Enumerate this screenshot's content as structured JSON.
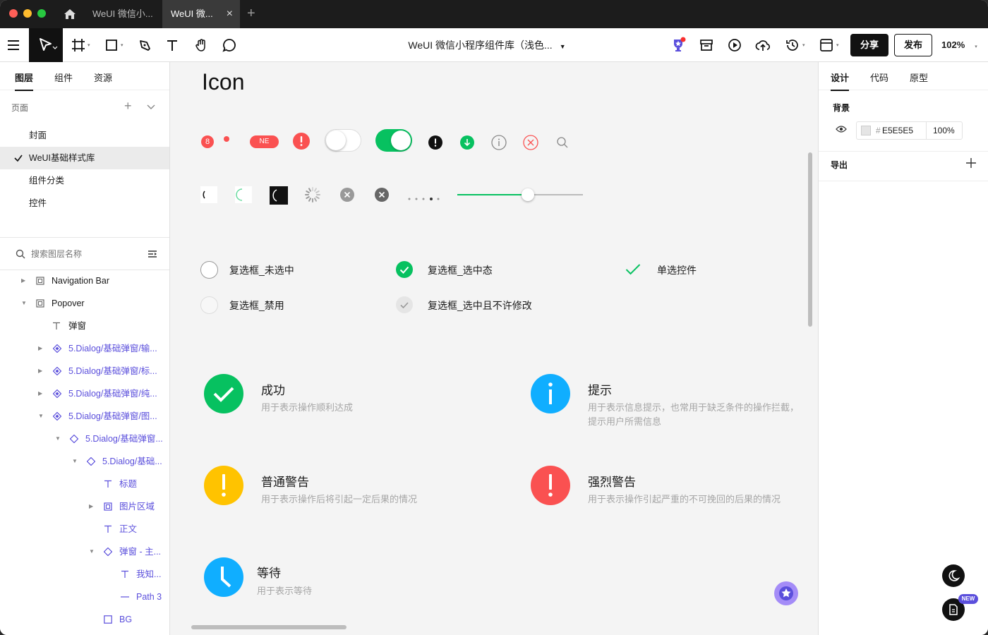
{
  "window": {
    "tabs": [
      {
        "label": "WeUI 微信小..."
      },
      {
        "label": "WeUI 微..."
      }
    ]
  },
  "toolbar": {
    "doc_title": "WeUI 微信小程序组件库（浅色...",
    "share_label": "分享",
    "publish_label": "发布",
    "zoom": "102%"
  },
  "left_panel": {
    "tabs": [
      "图层",
      "组件",
      "资源"
    ],
    "pages_header": "页面",
    "pages": [
      "封面",
      "WeUI基础样式库",
      "组件分类",
      "控件"
    ],
    "search_placeholder": "搜索图层名称",
    "layers": [
      {
        "label": "Navigation Bar",
        "type": "frame"
      },
      {
        "label": "Popover",
        "type": "frame"
      },
      {
        "label": "弹窗",
        "type": "text"
      },
      {
        "label": "5.Dialog/基础弹窗/输...",
        "type": "component"
      },
      {
        "label": "5.Dialog/基础弹窗/标...",
        "type": "component"
      },
      {
        "label": "5.Dialog/基础弹窗/纯...",
        "type": "component"
      },
      {
        "label": "5.Dialog/基础弹窗/图...",
        "type": "component"
      },
      {
        "label": "5.Dialog/基础弹窗...",
        "type": "instance"
      },
      {
        "label": "5.Dialog/基础...",
        "type": "instance"
      },
      {
        "label": "标题",
        "type": "text"
      },
      {
        "label": "图片区域",
        "type": "frame"
      },
      {
        "label": "正文",
        "type": "text"
      },
      {
        "label": "弹窗 - 主...",
        "type": "instance"
      },
      {
        "label": "我知...",
        "type": "text"
      },
      {
        "label": "Path 3",
        "type": "path"
      },
      {
        "label": "BG",
        "type": "rect"
      }
    ]
  },
  "canvas": {
    "heading": "Icon",
    "badge_number": "8",
    "badge_new": "NE",
    "checkbox_labels": {
      "unchecked": "复选框_未选中",
      "checked": "复选框_选中态",
      "radio": "单选控件",
      "disabled": "复选框_禁用",
      "checked_readonly": "复选框_选中且不许修改"
    },
    "status_items": [
      {
        "title": "成功",
        "desc": "用于表示操作顺利达成",
        "color": "#07c160"
      },
      {
        "title": "提示",
        "desc": "用于表示信息提示，也常用于缺乏条件的操作拦截，提示用户所需信息",
        "color": "#10aeff"
      },
      {
        "title": "普通警告",
        "desc": "用于表示操作后将引起一定后果的情况",
        "color": "#ffc300"
      },
      {
        "title": "强烈警告",
        "desc": "用于表示操作引起严重的不可挽回的后果的情况",
        "color": "#fa5151"
      },
      {
        "title": "等待",
        "desc": "用于表示等待",
        "color": "#10aeff"
      }
    ],
    "slider_value": 0.56
  },
  "right_panel": {
    "tabs": [
      "设计",
      "代码",
      "原型"
    ],
    "background_label": "背景",
    "background_hex": "E5E5E5",
    "background_opacity": "100",
    "percent_sign": "%",
    "export_label": "导出",
    "new_badge": "NEW"
  }
}
